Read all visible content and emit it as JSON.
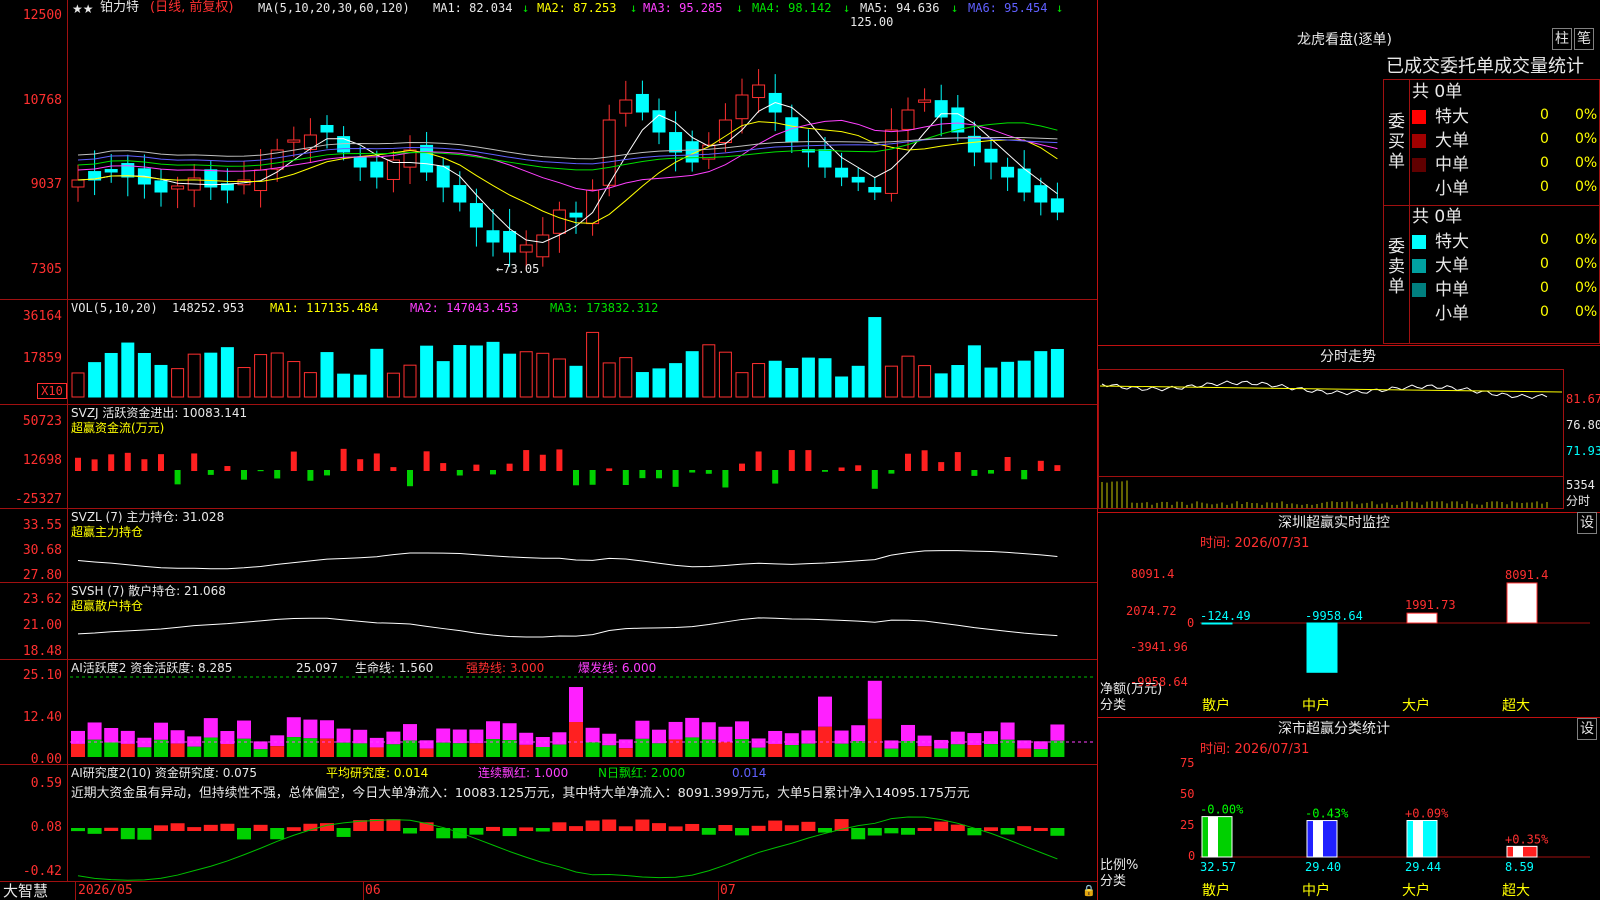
{
  "main": {
    "stock_name": "铂力特",
    "stock_mode": "(日线, 前复权)",
    "ma_label": "MA(5,10,20,30,60,120)",
    "ma1": "MA1: 82.034",
    "ma2": "MA2: 87.253",
    "ma3": "MA3: 95.285",
    "ma4": "MA4: 98.142",
    "ma5": "MA5: 94.636",
    "ma6": "MA6: 95.454",
    "arrow_down": "↓",
    "y_ticks": [
      "12500",
      "10768",
      "9037",
      "7305"
    ],
    "high_mark": "125.00",
    "low_mark": "←73.05",
    "x10_label": "X10"
  },
  "vol": {
    "label": "VOL(5,10,20)",
    "value": "148252.953",
    "ma1": "MA1: 117135.484",
    "ma2": "MA2: 147043.453",
    "ma3": "MA3: 173832.312",
    "y_ticks": [
      "36164",
      "17859"
    ]
  },
  "svzj": {
    "label": "SVZJ  活跃资金进出: 10083.141",
    "sub": "超赢资金流(万元)",
    "y_ticks": [
      "50723",
      "12698",
      "-25327"
    ]
  },
  "svzl": {
    "label": "SVZL (7) 主力持仓: 31.028",
    "sub": "超赢主力持仓",
    "y_ticks": [
      "33.55",
      "30.68",
      "27.80"
    ]
  },
  "svsh": {
    "label": "SVSH (7) 散户持仓: 21.068",
    "sub": "超赢散户持仓",
    "y_ticks": [
      "23.62",
      "21.00",
      "18.48"
    ]
  },
  "ai1": {
    "label": "AI活跃度2 资金活跃度: 8.285",
    "v2": "25.097",
    "life": "生命线: 1.560",
    "strong": "强势线: 3.000",
    "burst": "爆发线: 6.000",
    "y_ticks": [
      "25.10",
      "12.40",
      "0.00"
    ]
  },
  "ai2": {
    "label": "AI研究度2(10) 资金研究度: 0.075",
    "avg": "平均研究度: 0.014",
    "cont": "连续飘红: 1.000",
    "nday": "N日飘红: 2.000",
    "last": "0.014",
    "comment": "近期大资金虽有异动，但持续性不强，总体偏空，今日大单净流入：10083.125万元，其中特大单净流入：8091.399万元，大单5日累计净入14095.175万元",
    "y_ticks": [
      "0.59",
      "0.08",
      "-0.42"
    ]
  },
  "xaxis": {
    "logo": "大智慧",
    "labels": [
      "2026/05",
      "06",
      "07"
    ]
  },
  "right": {
    "lhb_title": "龙虎看盘(逐单)",
    "btn_bar": "柱",
    "btn_pen": "笔",
    "tabs": "已成交委托单成交量统计",
    "buy": {
      "side": [
        "委",
        "买",
        "单"
      ],
      "total": "共 0单",
      "rows": [
        {
          "name": "特大",
          "count": "0",
          "pct": "0%",
          "color": "#ff0000"
        },
        {
          "name": "大单",
          "count": "0",
          "pct": "0%",
          "color": "#a00000"
        },
        {
          "name": "中单",
          "count": "0",
          "pct": "0%",
          "color": "#600000"
        },
        {
          "name": "小单",
          "count": "0",
          "pct": "0%",
          "color": ""
        }
      ]
    },
    "sell": {
      "side": [
        "委",
        "卖",
        "单"
      ],
      "total": "共 0单",
      "rows": [
        {
          "name": "特大",
          "count": "0",
          "pct": "0%",
          "color": "#00ffff"
        },
        {
          "name": "大单",
          "count": "0",
          "pct": "0%",
          "color": "#00a0a0"
        },
        {
          "name": "中单",
          "count": "0",
          "pct": "0%",
          "color": "#008080"
        },
        {
          "name": "小单",
          "count": "0",
          "pct": "0%",
          "color": ""
        }
      ]
    },
    "fs_title": "分时走势",
    "fs_ticks": [
      "81.67",
      "76.80",
      "71.93",
      "5354",
      "分时"
    ],
    "monitor": {
      "title": "深圳超赢实时监控",
      "btn": "设",
      "time": "时间: 2026/07/31",
      "y_ticks": [
        "8091.4",
        "2074.72",
        "0",
        "-3941.96",
        "-9958.64"
      ],
      "unit": "净额(万元)",
      "cat_label": "分类",
      "chart_data": {
        "type": "bar",
        "categories": [
          "散户",
          "中户",
          "大户",
          "超大"
        ],
        "values": [
          -124.49,
          -9958.64,
          1991.73,
          8091.4
        ],
        "labels": [
          "-124.49",
          "-9958.64",
          "1991.73",
          "8091.4"
        ],
        "ylim": [
          -9958.64,
          8091.4
        ]
      }
    },
    "classify": {
      "title": "深市超赢分类统计",
      "btn": "设",
      "time": "时间: 2026/07/31",
      "y_ticks": [
        "75",
        "50",
        "25",
        "0"
      ],
      "unit": "比例%",
      "cat_label": "分类",
      "chart_data": {
        "type": "bar",
        "categories": [
          "散户",
          "中户",
          "大户",
          "超大"
        ],
        "values": [
          32.57,
          29.4,
          29.44,
          8.59
        ],
        "changes": [
          "-0.00%",
          "-0.43%",
          "+0.09%",
          "+0.35%"
        ],
        "value_labels": [
          "32.57",
          "29.40",
          "29.44",
          "8.59"
        ],
        "ylim": [
          0,
          75
        ]
      }
    }
  }
}
